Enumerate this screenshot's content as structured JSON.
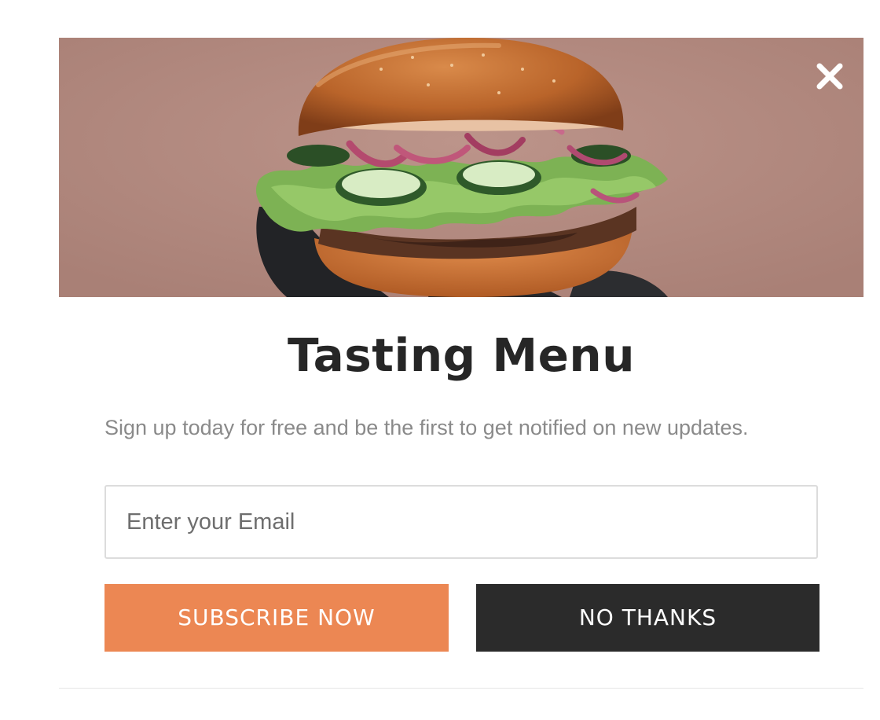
{
  "popup": {
    "title": "Tasting Menu",
    "subtitle": "Sign up today for free and be the first to get notified on new updates.",
    "email": {
      "placeholder": "Enter your Email",
      "value": ""
    },
    "subscribe_label": "SUBSCRIBE NOW",
    "no_thanks_label": "NO THANKS",
    "close_icon": "close-icon",
    "hero_image": "burger-photo"
  },
  "colors": {
    "hero_background": "#b48a80",
    "subscribe_button": "#ec8753",
    "no_thanks_button": "#2b2b2b",
    "title_text": "#262626",
    "subtitle_text": "#8a8a8a"
  }
}
